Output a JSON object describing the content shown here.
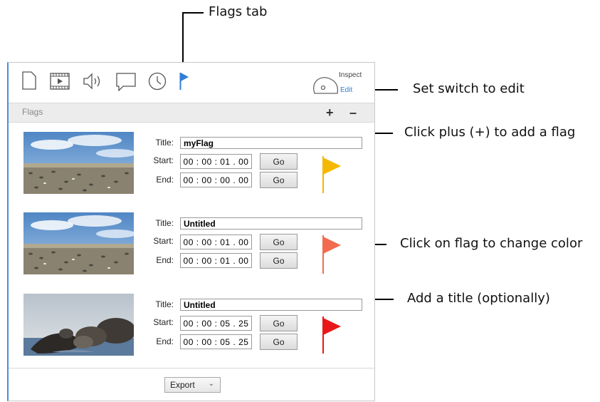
{
  "callouts": {
    "flags_tab": "Flags tab",
    "set_switch": "Set switch to edit",
    "click_plus": "Click plus (+) to add a flag",
    "click_flag": "Click on flag to change color",
    "add_title": "Add a title (optionally)"
  },
  "toolbar": {
    "icons": [
      "document-icon",
      "film-icon",
      "audio-icon",
      "comment-icon",
      "clock-icon",
      "flag-tab-icon"
    ],
    "active_tab": "flag-tab-icon",
    "inspect_label": "Inspect",
    "edit_label": "Edit",
    "accent_color": "#2f7fd6"
  },
  "flags_bar": {
    "title": "Flags",
    "add_label": "+",
    "remove_label": "–"
  },
  "field_labels": {
    "title": "Title:",
    "start": "Start:",
    "end": "End:",
    "go": "Go"
  },
  "flags": [
    {
      "title": "myFlag",
      "start": "00 : 00 : 01 . 00",
      "end": "00 : 00 : 00 . 00",
      "color": "#f5b800",
      "thumbnail": "birds-beach"
    },
    {
      "title": "Untitled",
      "start": "00 : 00 : 01 . 00",
      "end": "00 : 00 : 01 . 00",
      "color": "#f26b4f",
      "thumbnail": "birds-beach"
    },
    {
      "title": "Untitled",
      "start": "00 : 00 : 05 . 25",
      "end": "00 : 00 : 05 . 25",
      "color": "#e81818",
      "thumbnail": "seals-rocks"
    }
  ],
  "footer": {
    "export_label": "Export"
  }
}
